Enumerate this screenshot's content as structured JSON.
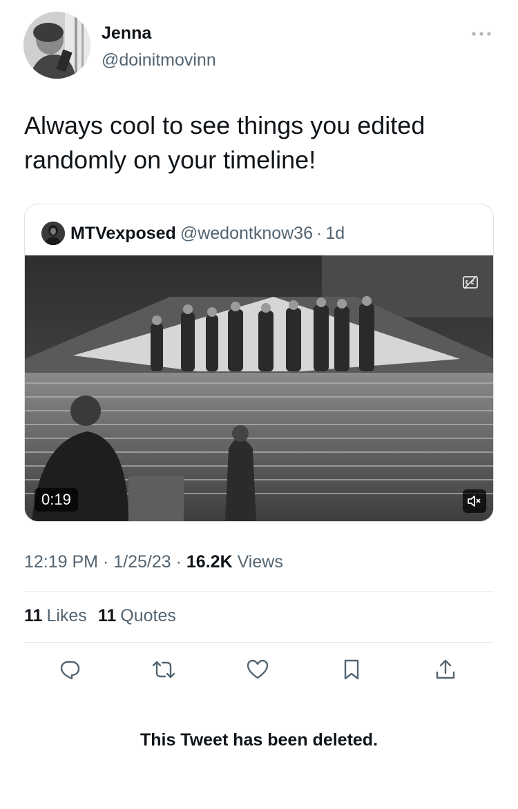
{
  "author": {
    "name": "Jenna",
    "handle": "@doinitmovinn"
  },
  "tweet": {
    "text": "Always cool to see things you edited randomly on your timeline!"
  },
  "quoted_tweet": {
    "name": "MTVexposed",
    "handle": "@wedontknow36",
    "separator": "·",
    "time": "1d",
    "video": {
      "duration": "0:19",
      "muted": true
    }
  },
  "meta": {
    "time": "12:19 PM",
    "separator": "·",
    "date": "1/25/23",
    "views_count": "16.2K",
    "views_label": "Views"
  },
  "stats": {
    "likes_count": "11",
    "likes_label": "Likes",
    "quotes_count": "11",
    "quotes_label": "Quotes"
  },
  "notice": {
    "deleted_text": "This Tweet has been deleted."
  },
  "icons": {
    "more": "more-horizontal-icon",
    "reply": "reply-icon",
    "retweet": "retweet-icon",
    "like": "heart-icon",
    "bookmark": "bookmark-icon",
    "share": "share-icon",
    "captions": "captions-icon",
    "mute": "volume-muted-icon"
  },
  "colors": {
    "text_primary": "#0f1419",
    "text_secondary": "#536471",
    "border": "#dde2e6"
  }
}
